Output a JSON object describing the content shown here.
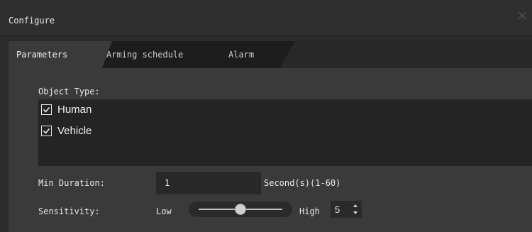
{
  "window": {
    "title": "Configure",
    "close_icon": "close-icon"
  },
  "tabs": [
    {
      "label": "Parameters",
      "active": true
    },
    {
      "label": "Arming schedule",
      "active": false
    },
    {
      "label": "Alarm",
      "active": false
    }
  ],
  "parameters": {
    "object_type_label": "Object Type:",
    "object_types": [
      {
        "label": "Human",
        "checked": true
      },
      {
        "label": "Vehicle",
        "checked": true
      }
    ],
    "min_duration": {
      "label": "Min Duration:",
      "value": "1",
      "unit_hint": "Second(s)(1-60)"
    },
    "sensitivity": {
      "label": "Sensitivity:",
      "low_label": "Low",
      "high_label": "High",
      "level_fraction": 0.5,
      "value": "5"
    }
  },
  "colors": {
    "background": "#2b2b2b",
    "panel": "#3a3a3a",
    "field": "#242424",
    "text": "#e6e6e6"
  }
}
